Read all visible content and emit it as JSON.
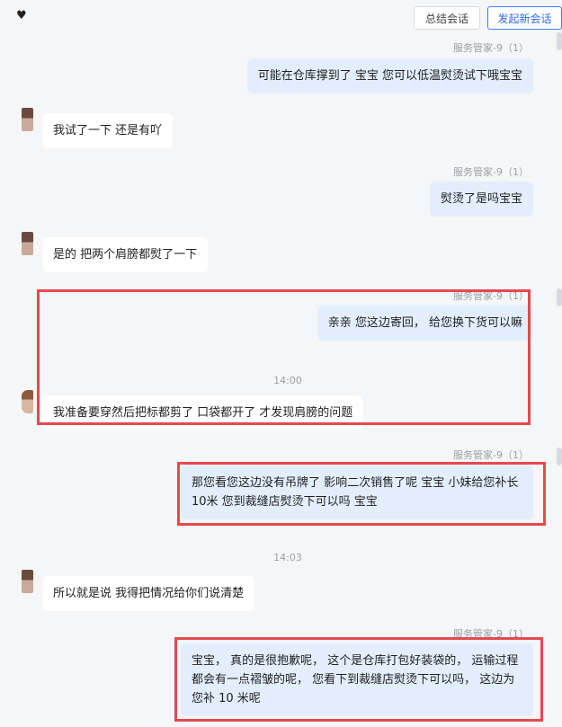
{
  "header": {
    "icon": "heart-icon",
    "close_label": "总结会话",
    "new_label": "发起新会话"
  },
  "agent_name": "服务管家-9（1）",
  "messages": {
    "m1": "可能在仓库撑到了 宝宝  您可以低温熨烫试下哦宝宝",
    "m2": "我试了一下  还是有吖",
    "m3": "熨烫了是吗宝宝",
    "m4": "是的  把两个肩膀都熨了一下",
    "m5": "亲亲 您这边寄回，  给您换下货可以嘛",
    "m6": "我准备要穿然后把标都剪了 口袋都开了  才发现肩膀的问题",
    "m7": "那您看您这边没有吊牌了 影响二次销售了呢 宝宝  小妹给您补长10米 您到裁缝店熨烫下可以吗   宝宝",
    "m8": "所以就是说  我得把情况给你们说清楚",
    "m9": "宝宝，   真的是很抱歉呢，  这个是仓库打包好装袋的，  运输过程都会有一点褶皱的呢，  您看下到裁缝店熨烫下可以吗，  这边为您补 10 米呢"
  },
  "times": {
    "t1": "14:00",
    "t2": "14:03"
  },
  "colors": {
    "highlight": "#e8484f",
    "outgoing": "#e2eefc",
    "accent": "#3f7bf7"
  }
}
